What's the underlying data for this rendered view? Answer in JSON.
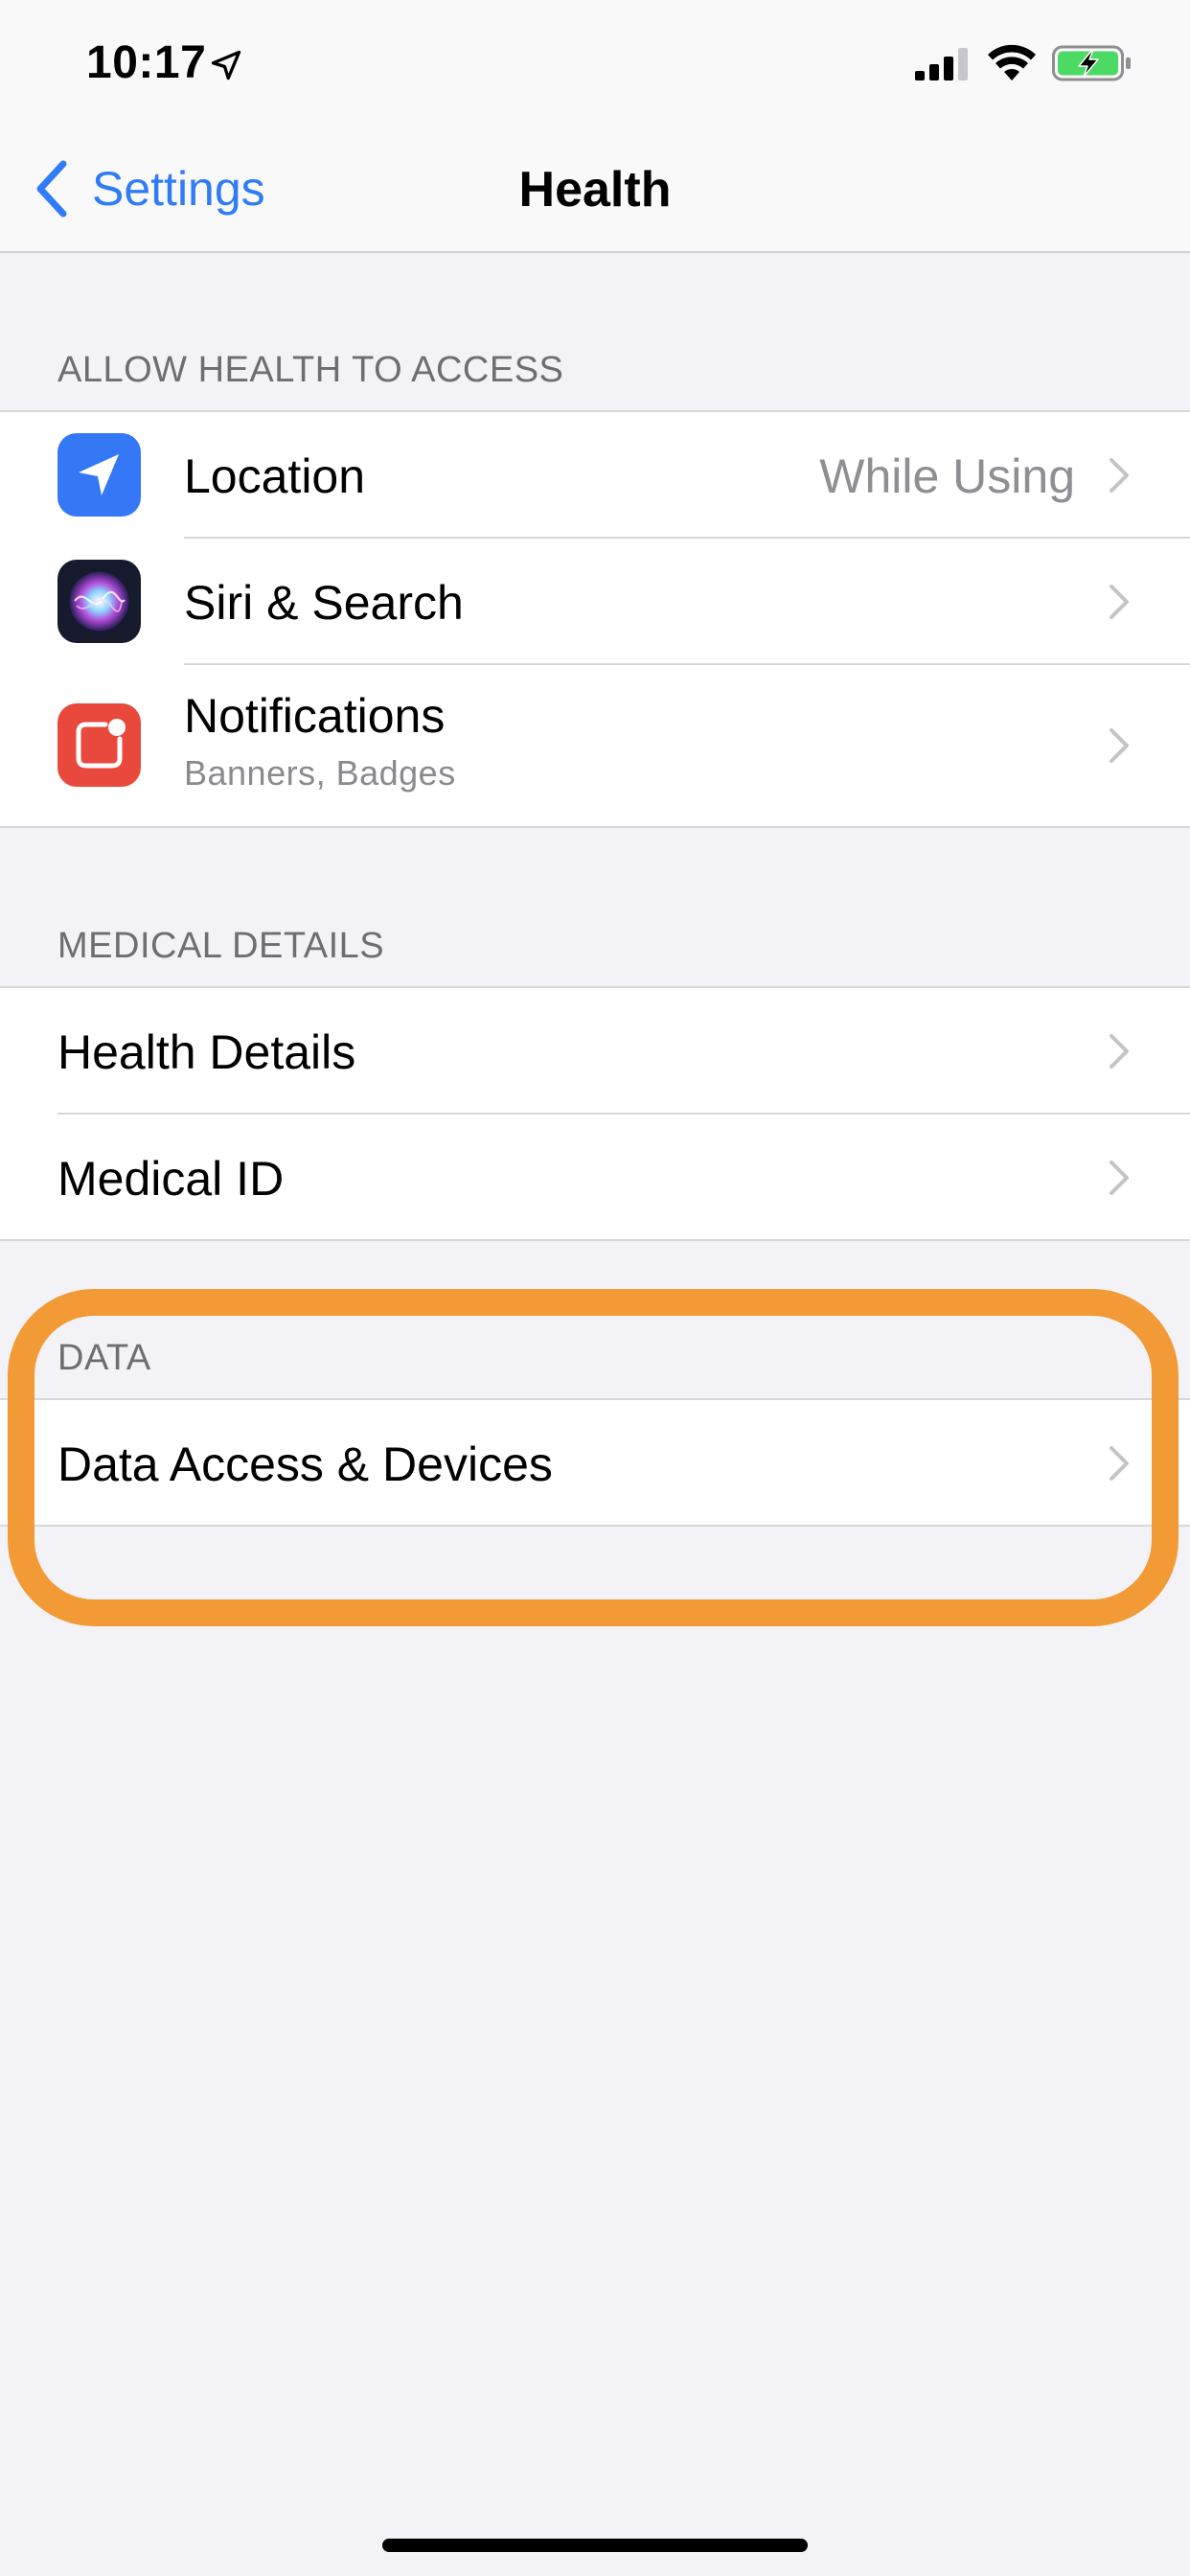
{
  "status_bar": {
    "time": "10:17",
    "battery_color": "#4cd964"
  },
  "nav": {
    "back_label": "Settings",
    "title": "Health"
  },
  "sections": {
    "allow_access": {
      "header": "ALLOW HEALTH TO ACCESS",
      "rows": [
        {
          "label": "Location",
          "value": "While Using",
          "icon": "location-arrow-icon",
          "icon_color": "#3478f6"
        },
        {
          "label": "Siri & Search",
          "icon": "siri-icon"
        },
        {
          "label": "Notifications",
          "subtitle": "Banners, Badges",
          "icon": "notifications-icon",
          "icon_color": "#e9483d"
        }
      ]
    },
    "medical_details": {
      "header": "MEDICAL DETAILS",
      "rows": [
        {
          "label": "Health Details"
        },
        {
          "label": "Medical ID"
        }
      ]
    },
    "data": {
      "header": "DATA",
      "rows": [
        {
          "label": "Data Access & Devices"
        }
      ]
    }
  },
  "highlight_color": "#f29a36",
  "accent_color": "#2f7cf6"
}
